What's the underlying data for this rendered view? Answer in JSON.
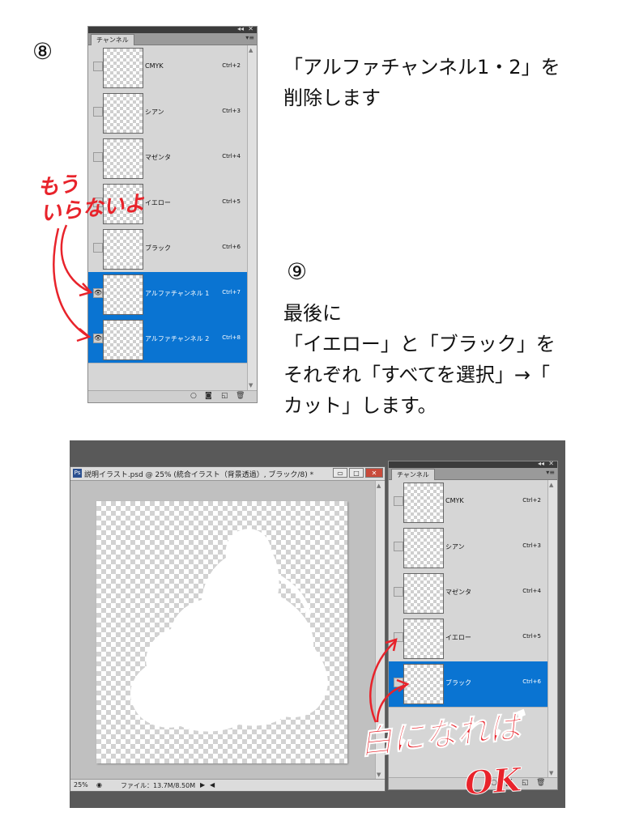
{
  "steps": {
    "step8": {
      "number": "⑧",
      "instruction": "「アルファチャンネル1・2」を\n削除します"
    },
    "step9": {
      "number": "⑨",
      "instruction": "最後に\n「イエロー」と「ブラック」を\nそれぞれ「すべてを選択」→「\nカット」します。"
    }
  },
  "panel1": {
    "tab": "チャンネル",
    "rows": [
      {
        "name": "CMYK",
        "shortcut": "Ctrl+2",
        "selected": false,
        "visible": false
      },
      {
        "name": "シアン",
        "shortcut": "Ctrl+3",
        "selected": false,
        "visible": false
      },
      {
        "name": "マゼンタ",
        "shortcut": "Ctrl+4",
        "selected": false,
        "visible": false
      },
      {
        "name": "イエロー",
        "shortcut": "Ctrl+5",
        "selected": false,
        "visible": false
      },
      {
        "name": "ブラック",
        "shortcut": "Ctrl+6",
        "selected": false,
        "visible": false
      },
      {
        "name": "アルファチャンネル 1",
        "shortcut": "Ctrl+7",
        "selected": true,
        "visible": true
      },
      {
        "name": "アルファチャンネル 2",
        "shortcut": "Ctrl+8",
        "selected": true,
        "visible": true
      }
    ]
  },
  "panel2": {
    "tab": "チャンネル",
    "rows": [
      {
        "name": "CMYK",
        "shortcut": "Ctrl+2",
        "selected": false
      },
      {
        "name": "シアン",
        "shortcut": "Ctrl+3",
        "selected": false
      },
      {
        "name": "マゼンタ",
        "shortcut": "Ctrl+4",
        "selected": false
      },
      {
        "name": "イエロー",
        "shortcut": "Ctrl+5",
        "selected": false
      },
      {
        "name": "ブラック",
        "shortcut": "Ctrl+6",
        "selected": true
      }
    ]
  },
  "document": {
    "app_icon": "Ps",
    "title": "説明イラスト.psd @ 25% (統合イラスト（背景透過）, ブラック/8) *",
    "zoom": "25%",
    "file_info": "ファイル：13.7M/8.50M"
  },
  "annotations": {
    "not_needed": "もう\nいらないよ",
    "white_ok_line1": "白になれば",
    "white_ok_line2": "OK"
  },
  "colors": {
    "selection": "#0a74d2",
    "annotation": "#e8232b",
    "panel_bg": "#d6d6d6"
  }
}
